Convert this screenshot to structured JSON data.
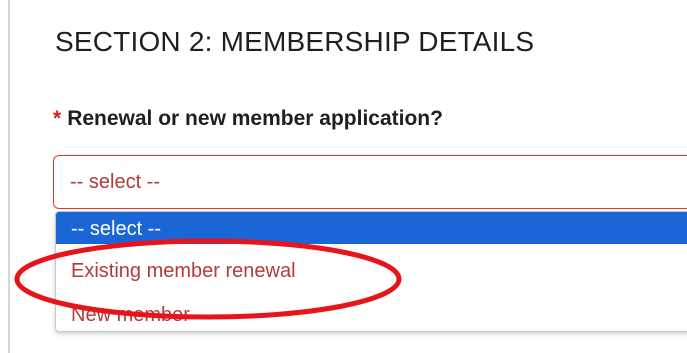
{
  "section": {
    "title": "SECTION 2: MEMBERSHIP DETAILS"
  },
  "question": {
    "required_marker": "*",
    "label": "Renewal or new member application?"
  },
  "select": {
    "current_value": "-- select --",
    "options": [
      {
        "label": "-- select --",
        "highlighted": true
      },
      {
        "label": "Existing member renewal",
        "highlighted": false
      },
      {
        "label": "New member",
        "highlighted": false
      }
    ]
  },
  "colors": {
    "required": "#e01b1b",
    "option_text": "#b23b3b",
    "highlight": "#1a66d6",
    "select_border": "#e53935",
    "annotation": "#e8141b"
  }
}
